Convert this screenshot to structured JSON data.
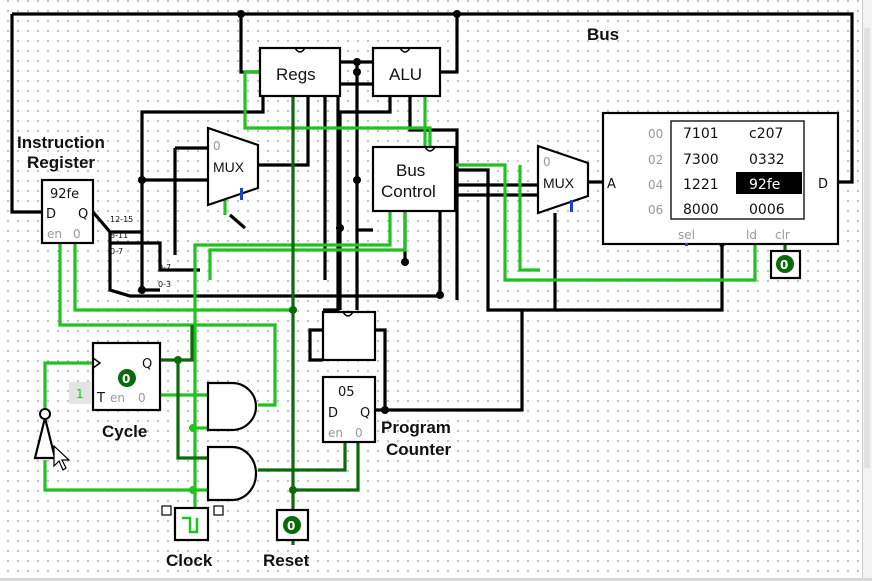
{
  "labels": {
    "bus": "Bus",
    "instruction_register": [
      "Instruction",
      "Register"
    ],
    "cycle": "Cycle",
    "program_counter": [
      "Program",
      "Counter"
    ],
    "clock": "Clock",
    "reset": "Reset"
  },
  "components": {
    "regs": "Regs",
    "alu": "ALU",
    "bus_control": [
      "Bus",
      "Control"
    ],
    "mux": "MUX",
    "ir": {
      "value": "92fe",
      "d": "D",
      "q": "Q",
      "en": "en",
      "clr": "0"
    },
    "pc": {
      "value": "05",
      "d": "D",
      "q": "Q",
      "en": "en",
      "clr": "0"
    },
    "cycle": {
      "value": "0",
      "t": "T",
      "en": "en",
      "clr": "0",
      "q": "Q",
      "constant": "1"
    },
    "reset_button": "0",
    "ram_clear_button": "0",
    "splitter_labels": [
      "12-15",
      "8-11",
      "0-7",
      "0-7",
      "0-3"
    ]
  },
  "ram": {
    "a_label": "A",
    "d_label": "D",
    "ports": [
      "sel",
      "ld",
      "clr"
    ],
    "addresses": [
      "00",
      "02",
      "04",
      "06"
    ],
    "rows": [
      [
        "7101",
        "c207"
      ],
      [
        "7300",
        "0332"
      ],
      [
        "1221",
        "92fe"
      ],
      [
        "8000",
        "0006"
      ]
    ],
    "highlighted": "92fe"
  },
  "colors": {
    "wire_off": "#0a6a0a",
    "wire_on": "#1fc21f",
    "wire_bus": "#000000",
    "highlight": "#000000"
  }
}
